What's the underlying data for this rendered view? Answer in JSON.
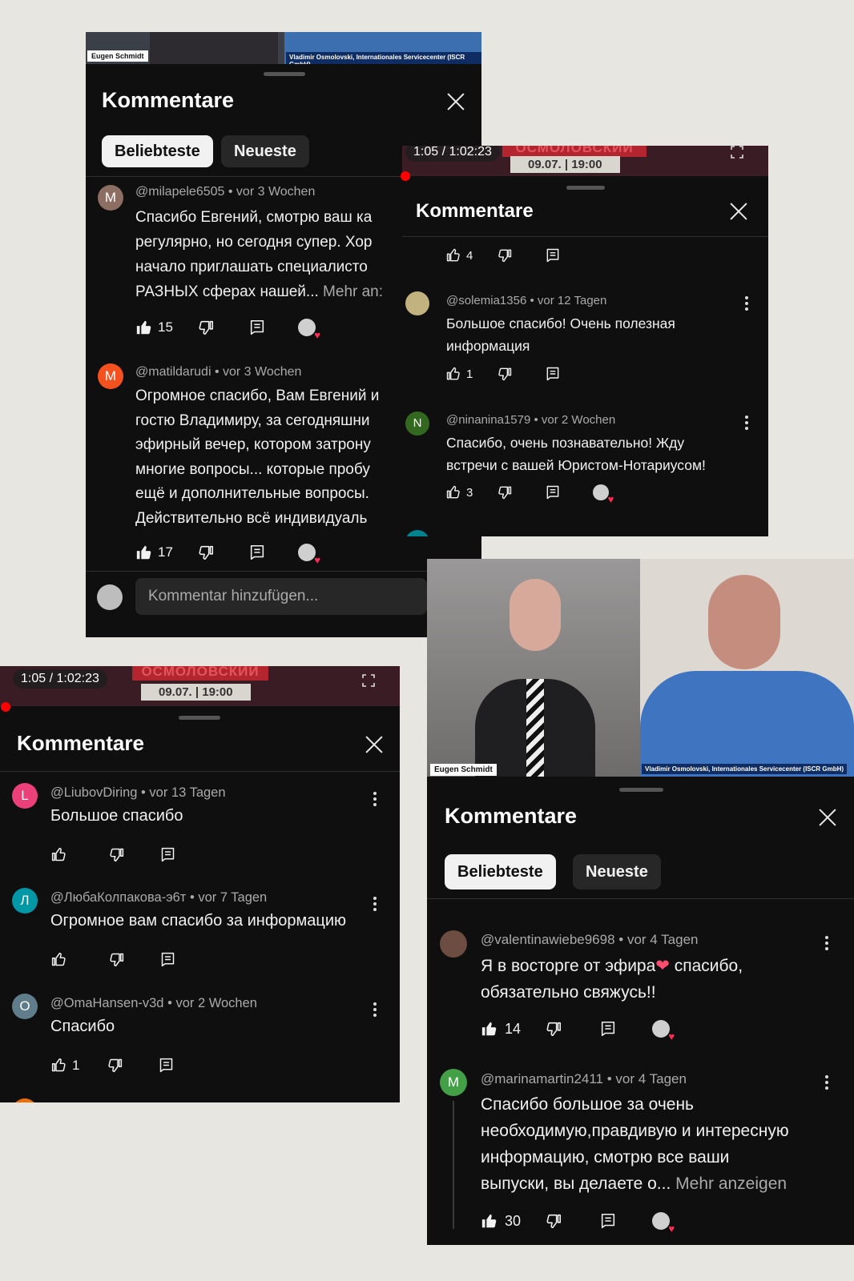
{
  "common": {
    "panel_title": "Kommentare",
    "tab_popular": "Beliebteste",
    "tab_newest": "Neueste",
    "more_label": "Mehr anzeigen",
    "add_comment_placeholder": "Kommentar hinzufügen...",
    "timecode": "1:05 / 1:02:23",
    "date_banner": "09.07. | 19:00",
    "banner_name": "ОСМОЛОВСКИЙ",
    "host_name": "Eugen Schmidt",
    "guest_name": "Vladimir Osmolovski, Internationales Servicecenter (ISCR GmbH)"
  },
  "panel1": {
    "comments": [
      {
        "avatar_letter": "M",
        "avatar_color": "#8d6e63",
        "author": "@milapele6505",
        "age": "vor 3 Wochen",
        "text": "Спасибо Евгений, смотрю ваш ка\nрегулярно, но сегодня супер. Хор\nначало приглашать специалисто\nРАЗНЫХ сферах нашей...",
        "more": "Mehr an:",
        "likes": "15"
      },
      {
        "avatar_letter": "M",
        "avatar_color": "#f4511e",
        "author": "@matildarudi",
        "age": "vor 3 Wochen",
        "text": "Огромное спасибо, Вам Евгений и\nгостю Владимиру, за сегодняшни\nэфирный вечер, котором затрону\nмногие вопросы... которые пробу\nещё и дополнительные вопросы.\nДействительно всё индивидуаль",
        "likes": "17"
      }
    ]
  },
  "panel2": {
    "top_likes": "4",
    "comments": [
      {
        "author": "@solemia1356",
        "age": "vor 12 Tagen",
        "text": "Большое спасибо! Очень полезная\nинформация",
        "likes": "1"
      },
      {
        "avatar_letter": "N",
        "avatar_color": "#33691e",
        "author": "@ninanina1579",
        "age": "vor 2 Wochen",
        "text": "Спасибо, очень познавательно! Жду\nвстречи с вашей Юристом-Нотариусом!",
        "likes": "3"
      }
    ]
  },
  "panel3": {
    "comments": [
      {
        "avatar_letter": "L",
        "avatar_color": "#ec407a",
        "author": "@LiubovDiring",
        "age": "vor 13 Tagen",
        "text": "Большое спасибо",
        "likes": ""
      },
      {
        "avatar_letter": "Л",
        "avatar_color": "#0097a7",
        "author": "@ЛюбаКолпакова-э6т",
        "age": "vor 7 Tagen",
        "text": "Огромное вам спасибо за информацию",
        "likes": ""
      },
      {
        "avatar_letter": "O",
        "avatar_color": "#607d8b",
        "author": "@OmaHansen-v3d",
        "age": "vor 2 Wochen",
        "text": "Спасибо",
        "likes": "1"
      }
    ]
  },
  "panel4": {
    "comments": [
      {
        "author": "@valentinawiebe9698",
        "age": "vor 4 Tagen",
        "text_a": "Я в восторге от эфира",
        "text_b": " спасибо,\nобязательно свяжусь!!",
        "likes": "14"
      },
      {
        "avatar_letter": "M",
        "avatar_color": "#43a047",
        "author": "@marinamartin2411",
        "age": "vor 4 Tagen",
        "text": "Спасибо большое за очень\nнеобходимую,правдивую и интересную\nинформацию, смотрю все ваши\nвыпуски, вы делаете о...",
        "more": "Mehr anzeigen",
        "likes": "30"
      }
    ]
  }
}
